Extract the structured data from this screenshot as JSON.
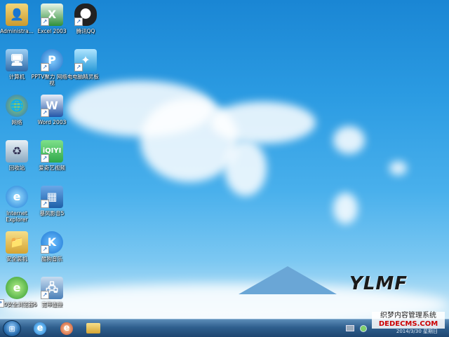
{
  "desktop": {
    "icons": [
      {
        "label": "Administra...",
        "icon": "user-folder-icon",
        "color": "#e0b84a"
      },
      {
        "label": "Excel 2003",
        "icon": "excel-icon",
        "color": "#2f8f3a"
      },
      {
        "label": "腾讯QQ",
        "icon": "qq-penguin-icon",
        "color": "#222222"
      },
      {
        "label": "计算机",
        "icon": "computer-icon",
        "color": "#3a7fc4"
      },
      {
        "label": "PPTV聚力 网络电视",
        "icon": "pptv-icon",
        "color": "#1e6fc7"
      },
      {
        "label": "电脑精灵板",
        "icon": "sprite-icon",
        "color": "#2a9ad8"
      },
      {
        "label": "网络",
        "icon": "network-globe-icon",
        "color": "#2e86c8"
      },
      {
        "label": "Word 2003",
        "icon": "word-icon",
        "color": "#2256a8"
      },
      {
        "label": "回收站",
        "icon": "recycle-bin-icon",
        "color": "#8aa8c0"
      },
      {
        "label": "爱奇艺视频",
        "icon": "iqiyi-icon",
        "color": "#2fa84a"
      },
      {
        "label": "Internet Explorer",
        "icon": "ie-icon",
        "color": "#1e7ed8"
      },
      {
        "label": "暴风影音5",
        "icon": "baofeng-icon",
        "color": "#1d5fa8"
      },
      {
        "label": "安全装机",
        "icon": "folder-icon",
        "color": "#e0b84a"
      },
      {
        "label": "酷狗音乐",
        "icon": "kugou-icon",
        "color": "#1e78d4"
      },
      {
        "label": "360安全浏览器6",
        "icon": "360-browser-icon",
        "color": "#3aa83a"
      },
      {
        "label": "宽带连接",
        "icon": "broadband-icon",
        "color": "#4a7fb8"
      }
    ],
    "logo_text": "YLMF"
  },
  "taskbar": {
    "start_icon": "windows-start-icon",
    "pinned": [
      {
        "name": "ie-taskbar",
        "icon": "ie-icon"
      },
      {
        "name": "360-taskbar",
        "icon": "360-browser-icon"
      },
      {
        "name": "explorer-taskbar",
        "icon": "folder-icon"
      }
    ],
    "clock_date": "2014/3/30 星期日"
  },
  "watermark": {
    "line1": "织梦内容管理系统",
    "line2": "DEDECMS.COM"
  }
}
